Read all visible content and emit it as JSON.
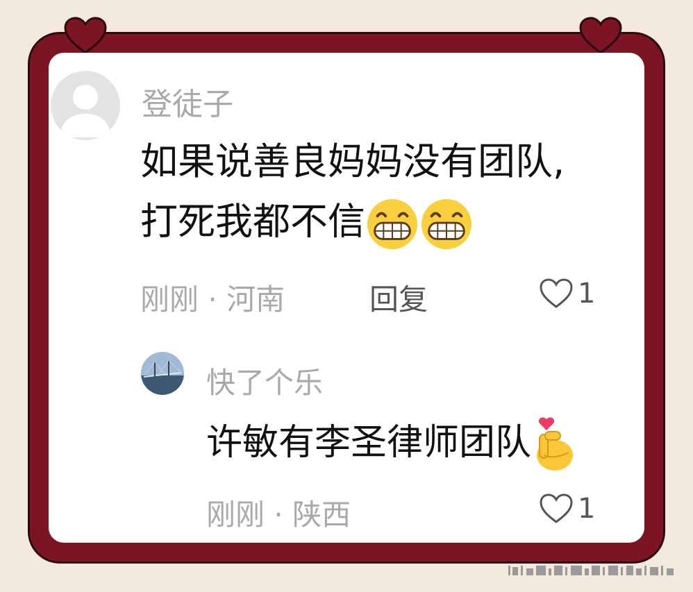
{
  "comments": [
    {
      "username": "登徒子",
      "text_line1": "如果说善良妈妈没有团队,",
      "text_line2": "打死我都不信",
      "emojis": [
        "grin-emoji",
        "grin-emoji"
      ],
      "time": "刚刚",
      "separator": "·",
      "location": "河南",
      "reply_label": "回复",
      "likes": "1"
    }
  ],
  "replies": [
    {
      "username": "快了个乐",
      "text": "许敏有李圣律师团队",
      "emoji": "finger-heart-emoji",
      "time": "刚刚",
      "separator": "·",
      "location": "陕西",
      "likes": "1"
    }
  ],
  "colors": {
    "frame": "#7c1424",
    "background": "#f3e9dc",
    "meta_text": "#a9a9a9",
    "body_text": "#111111"
  }
}
